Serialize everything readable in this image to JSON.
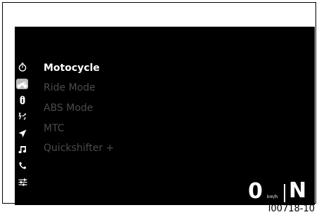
{
  "menu": {
    "items": [
      {
        "label": "Motocycle",
        "state": "selected"
      },
      {
        "label": "Ride Mode",
        "state": "dim"
      },
      {
        "label": "ABS Mode",
        "state": "dim"
      },
      {
        "label": "MTC",
        "state": "dim"
      },
      {
        "label": "Quickshifter +",
        "state": "dim"
      }
    ]
  },
  "side_icons": [
    {
      "name": "stopwatch-icon"
    },
    {
      "name": "motorcycle-icon",
      "active": true
    },
    {
      "name": "info-icon"
    },
    {
      "name": "traffic-info-icon"
    },
    {
      "name": "navigation-arrow-icon"
    },
    {
      "name": "music-note-icon"
    },
    {
      "name": "phone-icon"
    },
    {
      "name": "settings-sliders-icon"
    }
  ],
  "status": {
    "speed": "0",
    "speed_unit": "km/h",
    "gear": "N"
  },
  "figure_code": "I00718-10",
  "colors": {
    "background": "#000000",
    "text_selected": "#ffffff",
    "text_dim": "#4b4b4b",
    "active_icon_bg": "#bdbdbd"
  }
}
